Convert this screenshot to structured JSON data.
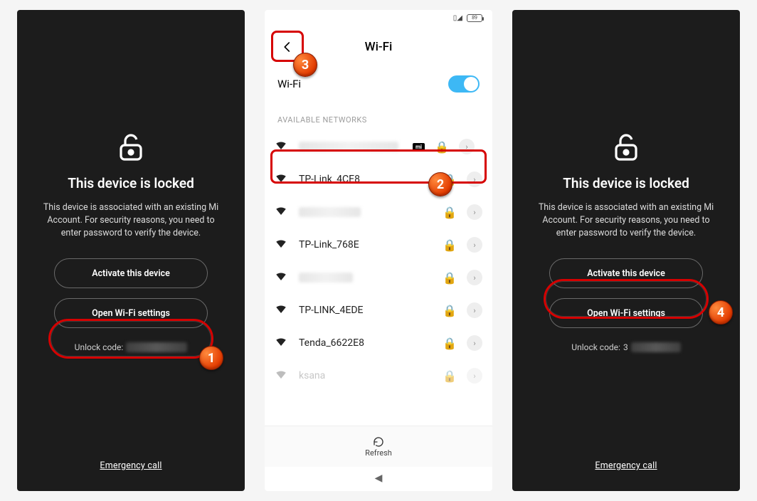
{
  "lockScreen": {
    "title": "This device is locked",
    "desc": "This device is associated with an existing Mi Account. For security reasons, you need to enter password to verify the device.",
    "activateBtn": "Activate this device",
    "wifiBtn": "Open Wi-Fi settings",
    "unlockLabel": "Unlock code:",
    "emergency": "Emergency call"
  },
  "wifiScreen": {
    "title": "Wi-Fi",
    "toggleLabel": "Wi-Fi",
    "sectionLabel": "AVAILABLE NETWORKS",
    "refreshLabel": "Refresh",
    "batteryLevel": "89",
    "miBadge": "mi",
    "networks": {
      "n1_blurred": true,
      "n2": "TP-Link_4CE8",
      "n3_blurred": true,
      "n4": "TP-Link_768E",
      "n5_blurred": true,
      "n6": "TP-LINK_4EDE",
      "n7": "Tenda_6622E8",
      "n8_partial": "ksana"
    }
  },
  "badges": {
    "b1": "1",
    "b2": "2",
    "b3": "3",
    "b4": "4"
  }
}
